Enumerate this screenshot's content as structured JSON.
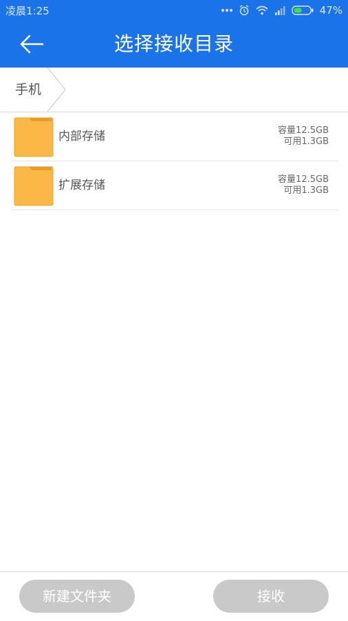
{
  "status_bar": {
    "time": "凌晨1:25",
    "battery": "47%",
    "icons": [
      "more-dots-icon",
      "alarm-icon",
      "wifi-icon",
      "signal-icon",
      "battery-icon"
    ]
  },
  "app_bar": {
    "title": "选择接收目录",
    "back_icon": "back-arrow-icon",
    "color": "#1a73e8"
  },
  "breadcrumb": {
    "items": [
      {
        "label": "手机"
      }
    ]
  },
  "list": {
    "items": [
      {
        "name": "内部存储",
        "capacity": "容量12.5GB",
        "available": "可用1.3GB",
        "icon": "folder-icon"
      },
      {
        "name": "扩展存储",
        "capacity": "容量12.5GB",
        "available": "可用1.3GB",
        "icon": "folder-icon"
      }
    ]
  },
  "footer": {
    "new_folder_label": "新建文件夹",
    "receive_label": "接收"
  }
}
